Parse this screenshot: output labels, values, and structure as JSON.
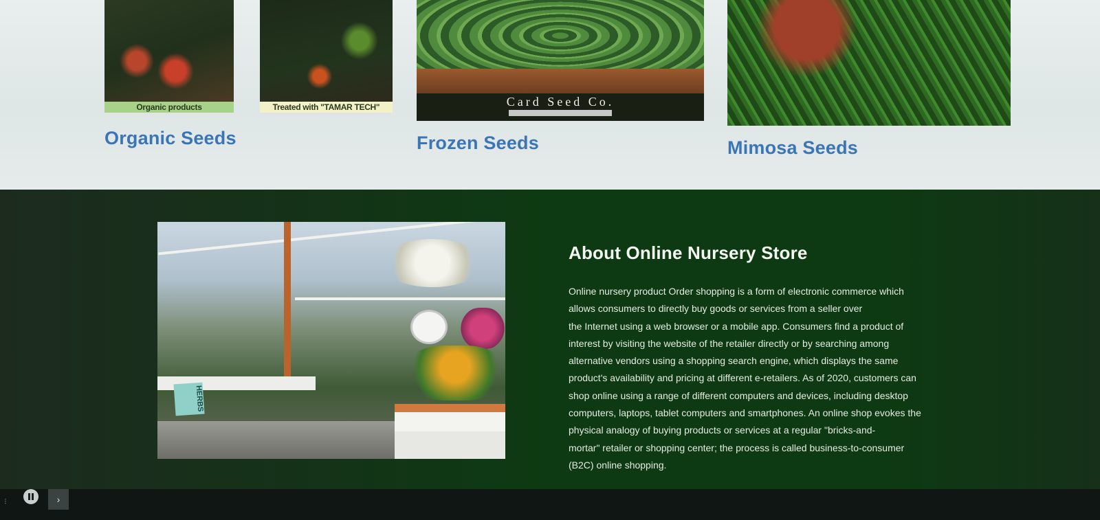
{
  "products": [
    {
      "title": "Organic Seeds",
      "captions": [
        "Organic products",
        "Treated with \"TAMAR TECH\""
      ]
    },
    {
      "title": "Frozen Seeds",
      "brand": "Card Seed Co."
    },
    {
      "title": "Mimosa Seeds"
    }
  ],
  "about": {
    "title": "About Online Nursery Store",
    "paragraph_lines": [
      "Online nursery product Order shopping is a form of electronic commerce which",
      "allows consumers to directly buy goods or services from a seller over",
      "the Internet using a web browser or a mobile app. Consumers find a product of",
      "interest by visiting the website of the retailer directly or by searching among",
      "alternative vendors using a shopping search engine, which displays the same",
      "product's availability and pricing at different e-retailers. As of 2020, customers can",
      "shop online using a range of different computers and devices, including desktop",
      "computers, laptops, tablet computers and smartphones. An online shop evokes the",
      "physical analogy of buying products or services at a regular \"bricks-and-",
      "mortar\" retailer or shopping center; the process is called business-to-consumer",
      "(B2C) online shopping."
    ],
    "image_sign": "HERBS"
  },
  "player": {
    "pause_icon": "pause-icon",
    "next_icon": "chevron-right-icon",
    "next_glyph": "›"
  },
  "colors": {
    "product_title": "#3a76b6",
    "about_background": "#0d3a12",
    "about_text": "#e6ece3"
  }
}
